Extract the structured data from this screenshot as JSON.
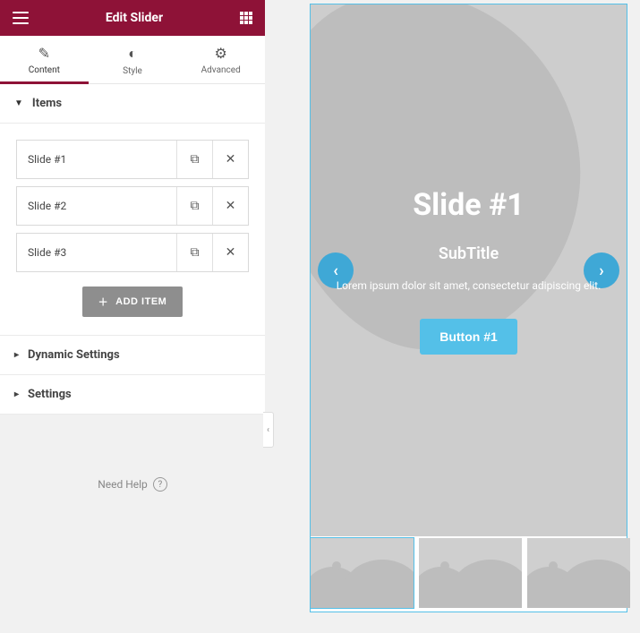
{
  "header": {
    "title": "Edit Slider"
  },
  "tabs": {
    "content": "Content",
    "style": "Style",
    "advanced": "Advanced"
  },
  "sections": {
    "items": {
      "label": "Items",
      "expanded": true
    },
    "dynamic": {
      "label": "Dynamic Settings"
    },
    "settings": {
      "label": "Settings"
    }
  },
  "items": [
    {
      "label": "Slide #1"
    },
    {
      "label": "Slide #2"
    },
    {
      "label": "Slide #3"
    }
  ],
  "addItem": "ADD ITEM",
  "help": "Need Help",
  "preview": {
    "title": "Slide #1",
    "subtitle": "SubTitle",
    "description": "Lorem ipsum dolor sit amet, consectetur adipiscing elit.",
    "button": "Button #1"
  },
  "colors": {
    "accent": "#8e1237",
    "previewAccent": "#54c0e8"
  }
}
